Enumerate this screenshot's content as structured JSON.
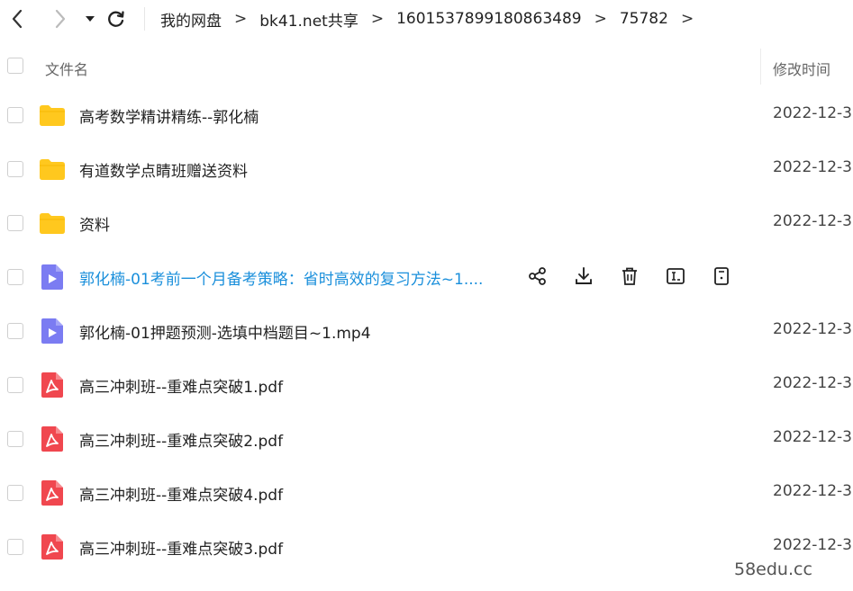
{
  "breadcrumb": [
    "我的网盘",
    "bk41.net共享",
    "1601537899180863489",
    "75782"
  ],
  "header": {
    "name_label": "文件名",
    "time_label": "修改时间"
  },
  "files": [
    {
      "name": "高考数学精讲精练--郭化楠",
      "type": "folder",
      "time": "2022-12-3"
    },
    {
      "name": "有道数学点睛班赠送资料",
      "type": "folder",
      "time": "2022-12-3"
    },
    {
      "name": "资料",
      "type": "folder",
      "time": "2022-12-3"
    },
    {
      "name": "郭化楠-01考前一个月备考策略：省时高效的复习方法~1....",
      "type": "video",
      "time": "",
      "hovered": true
    },
    {
      "name": "郭化楠-01押题预测-选填中档题目~1.mp4",
      "type": "video",
      "time": "2022-12-3"
    },
    {
      "name": "高三冲刺班--重难点突破1.pdf",
      "type": "pdf",
      "time": "2022-12-3"
    },
    {
      "name": "高三冲刺班--重难点突破2.pdf",
      "type": "pdf",
      "time": "2022-12-3"
    },
    {
      "name": "高三冲刺班--重难点突破4.pdf",
      "type": "pdf",
      "time": "2022-12-3"
    },
    {
      "name": "高三冲刺班--重难点突破3.pdf",
      "type": "pdf",
      "time": "2022-12-3"
    }
  ],
  "row_actions": [
    "share-icon",
    "download-icon",
    "delete-icon",
    "rename-icon",
    "more-info-icon"
  ],
  "colors": {
    "folder": "#ffc81e",
    "video": "#7b7cf2",
    "pdf": "#f0474f",
    "highlight": "#1a8fdb"
  },
  "watermark": "58edu.cc"
}
